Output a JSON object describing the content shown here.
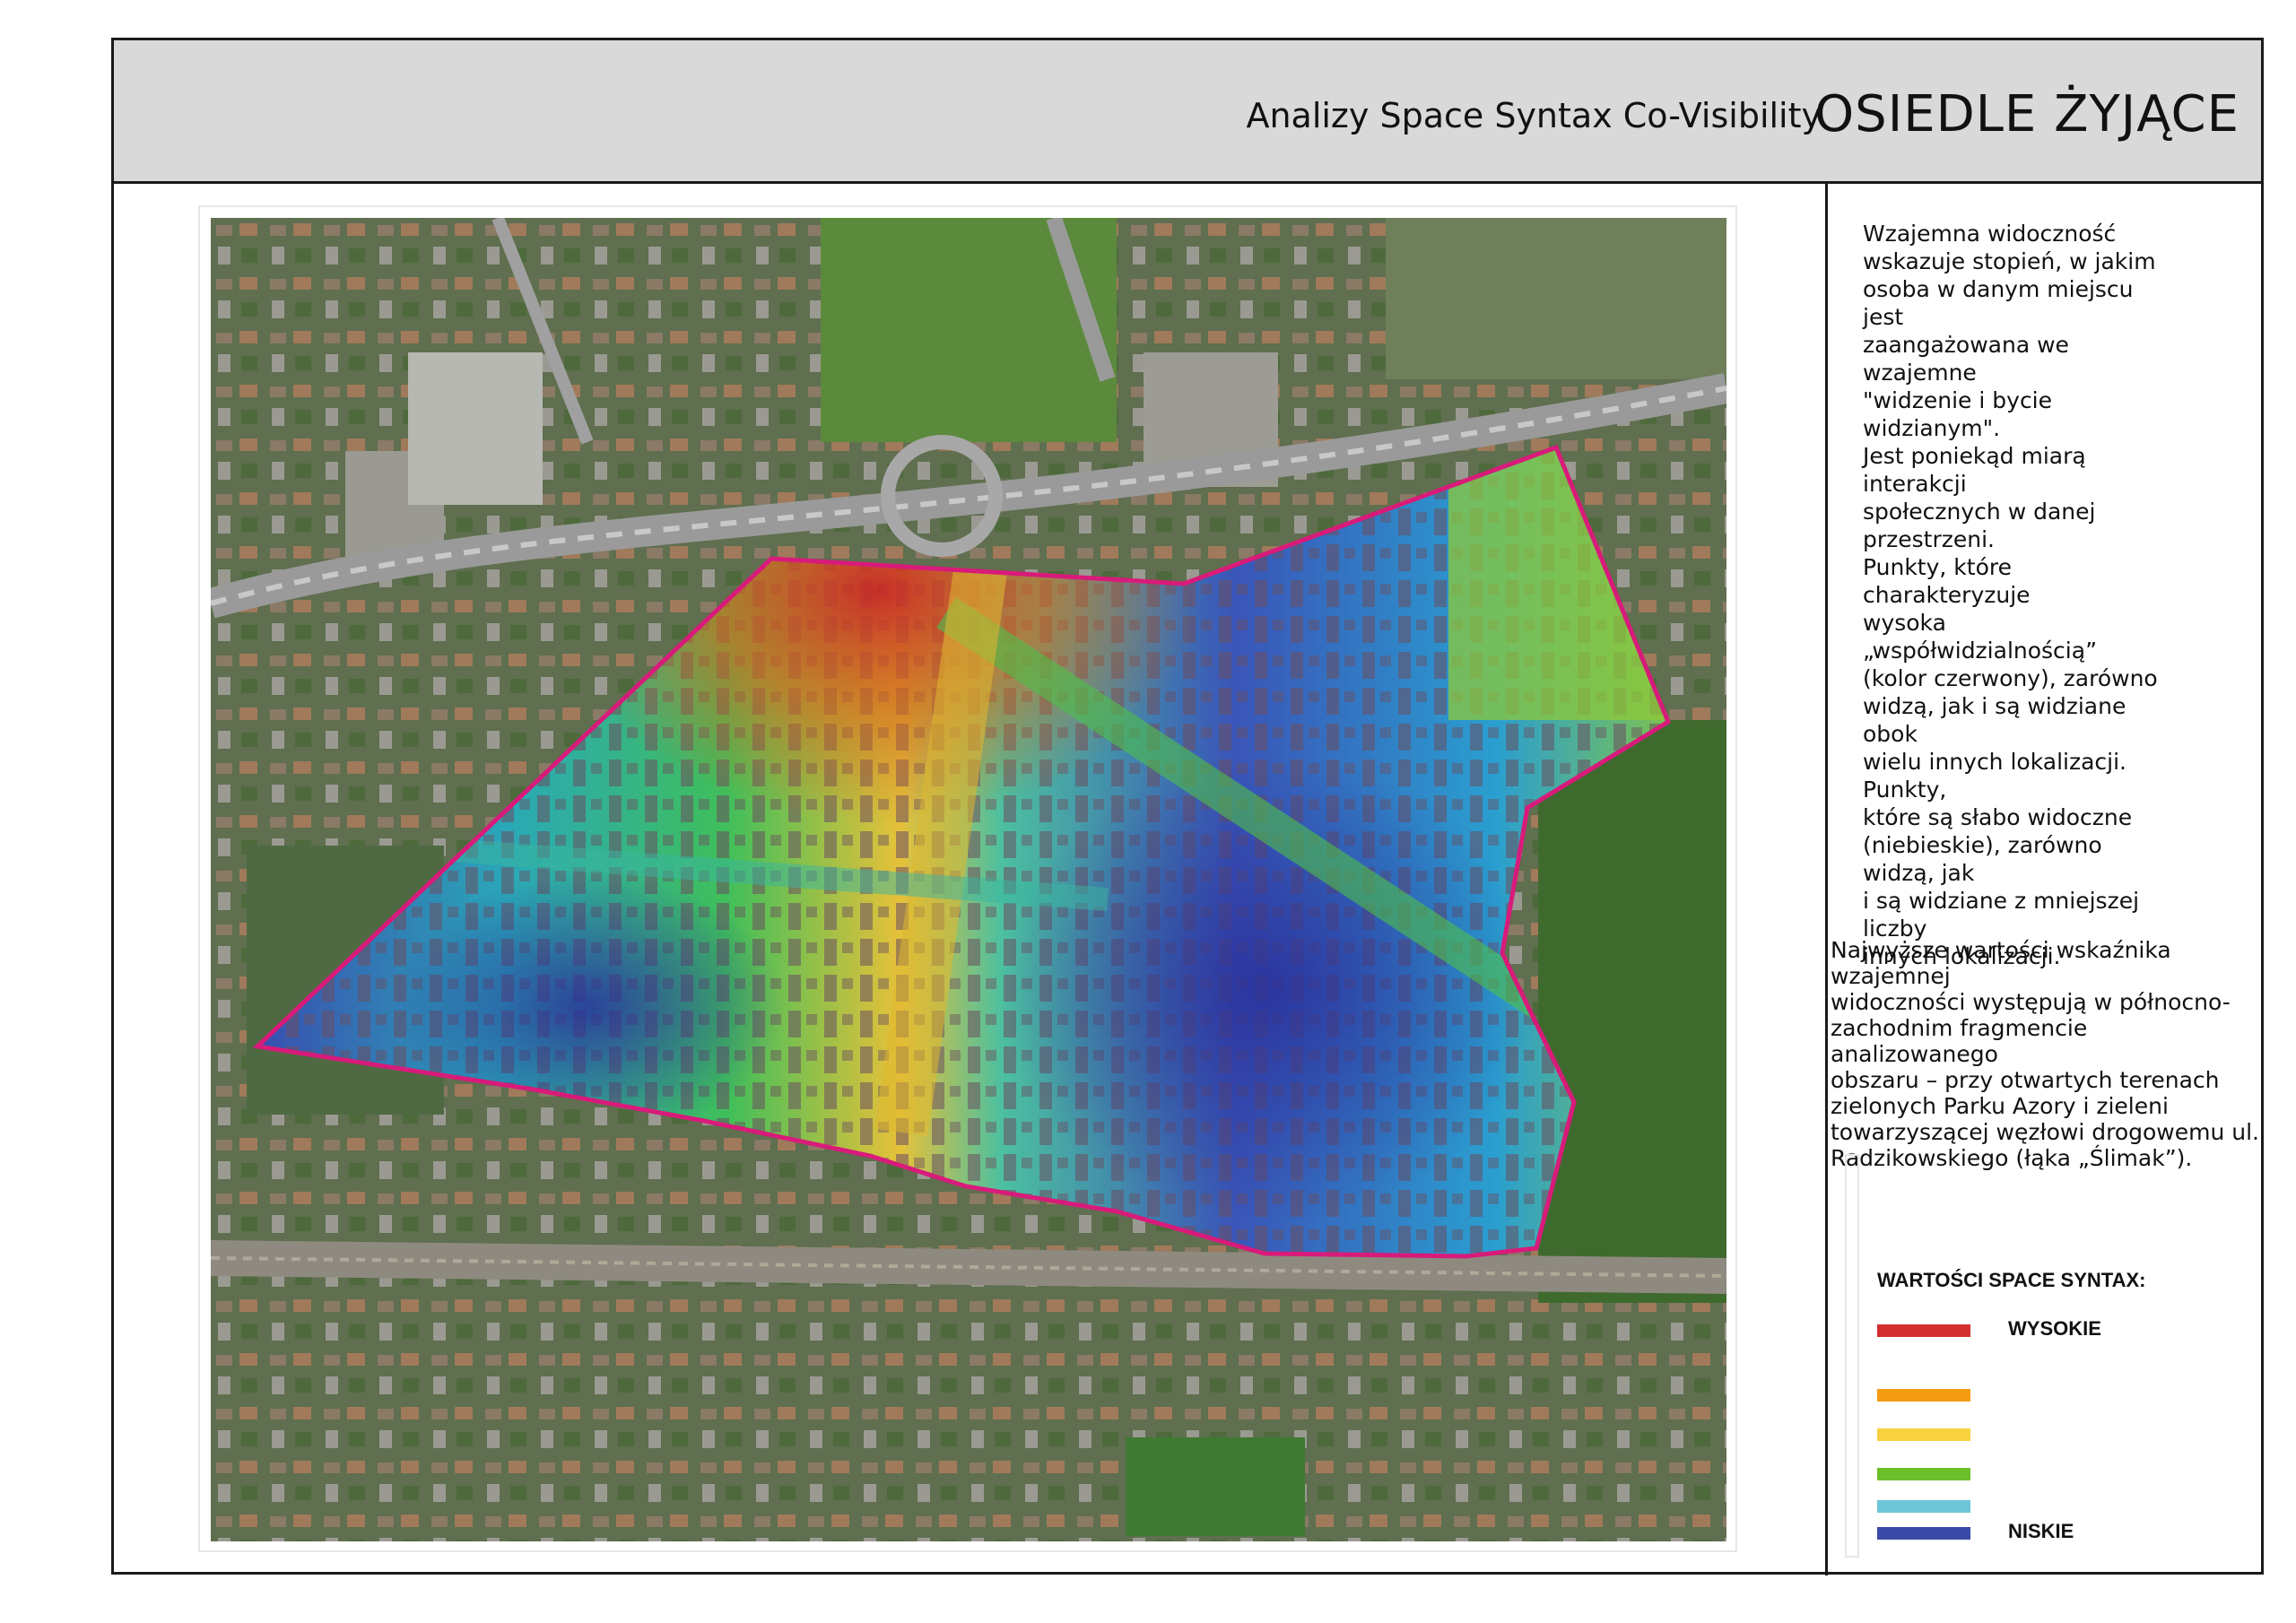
{
  "header": {
    "subtitle": "Analizy Space Syntax Co-Visibility",
    "title": "OSIEDLE ŻYJĄCE"
  },
  "description": "Wzajemna widoczność\nwskazuje stopień, w jakim\nosoba w danym miejscu jest\nzaangażowana we wzajemne\n\"widzenie i bycie widzianym\".\nJest poniekąd miarą interakcji\nspołecznych w danej\nprzestrzeni.\nPunkty, które charakteryzuje\nwysoka „współwidzialnością”\n(kolor czerwony), zarówno\nwidzą, jak i są widziane obok\nwielu innych lokalizacji. Punkty,\nktóre są słabo widoczne\n(niebieskie), zarówno widzą, jak\ni są widziane z mniejszej liczby\ninnych lokalizacji.",
  "note": "Najwyższe wartości wskaźnika wzajemnej\nwidoczności występują w północno-\nzachodnim fragmencie analizowanego\nobszaru – przy otwartych terenach\nzielonych Parku Azory i zieleni\ntowarzyszącej węzłowi drogowemu ul.\nRadzikowskiego (łąka „Ślimak”).",
  "legend": {
    "title": "WARTOŚCI SPACE SYNTAX:",
    "high_label": "WYSOKIE",
    "low_label": "NISKIE",
    "colors": [
      "#d32f2f",
      "#f39c12",
      "#f7d23e",
      "#6bbf2a",
      "#6cc6d8",
      "#3a4aa8"
    ]
  },
  "map": {
    "boundary_color": "#d81b7a",
    "icon": "aerial-map-image"
  }
}
